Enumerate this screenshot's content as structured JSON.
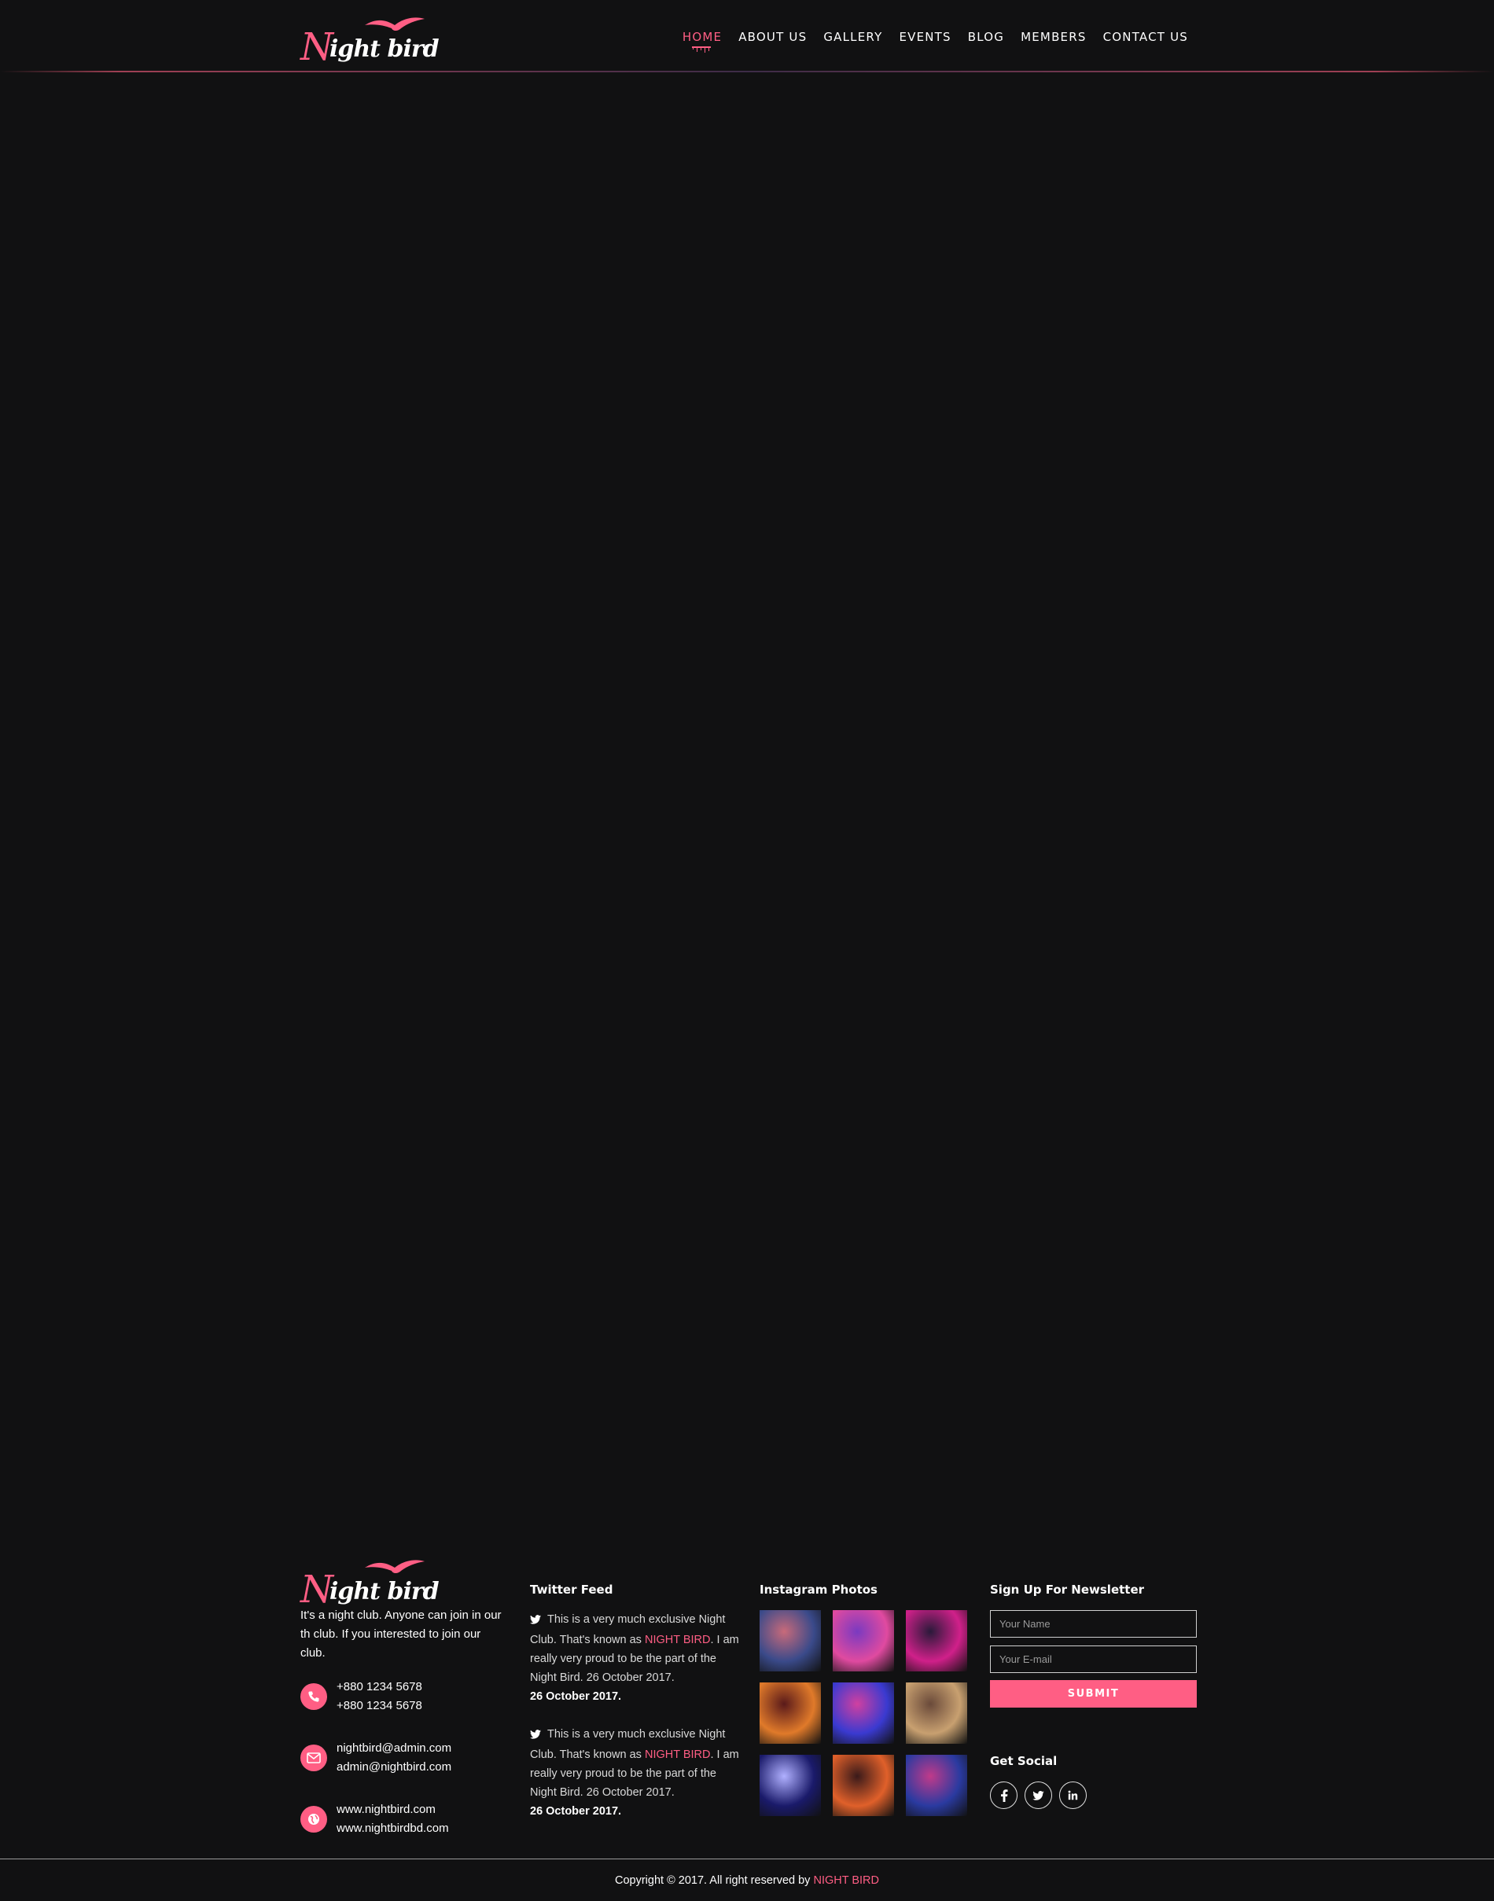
{
  "header": {
    "logo": {
      "text_cap": "N",
      "text_rest": "ight bird"
    },
    "nav": [
      {
        "label": "HOME",
        "active": true
      },
      {
        "label": "ABOUT US"
      },
      {
        "label": "GALLERY"
      },
      {
        "label": "EVENTS"
      },
      {
        "label": "BLOG"
      },
      {
        "label": "MEMBERS"
      },
      {
        "label": "CONTACT US"
      }
    ]
  },
  "footer": {
    "about": {
      "logo_cap": "N",
      "logo_rest": "ight bird",
      "description": "It's a night club. Anyone can join in our th club. If you interested to join our club.",
      "phones": [
        "+880 1234 5678",
        "+880 1234 5678"
      ],
      "emails": [
        "nightbird@admin.com",
        "admin@nightbird.com"
      ],
      "websites": [
        "www.nightbird.com",
        "www.nightbirdbd.com"
      ]
    },
    "twitter": {
      "heading": "Twitter Feed",
      "tweets": [
        {
          "pre": "This is a very much exclusive Night Club. That's known as ",
          "highlight": "NIGHT BIRD",
          "post": ". I am really very proud to be the part of the Night Bird. 26 October 2017.",
          "date": "26 October 2017."
        },
        {
          "pre": "This is a very much exclusive Night Club. That's known as ",
          "highlight": "NIGHT BIRD",
          "post": ". I am really very proud to be the part of the Night Bird. 26 October 2017.",
          "date": "26 October 2017."
        }
      ]
    },
    "instagram": {
      "heading": "Instagram Photos",
      "photos": [
        {
          "name": "photo-1",
          "c1": "#3a4a8a",
          "c2": "#c86a7a"
        },
        {
          "name": "photo-2",
          "c1": "#e04aa0",
          "c2": "#7a3ac0"
        },
        {
          "name": "photo-3",
          "c1": "#d0208a",
          "c2": "#2a1a3a"
        },
        {
          "name": "photo-4",
          "c1": "#e07a2a",
          "c2": "#5a1a1a"
        },
        {
          "name": "photo-5",
          "c1": "#3a3ad0",
          "c2": "#d040a0"
        },
        {
          "name": "photo-6",
          "c1": "#c8a070",
          "c2": "#6a4a3a"
        },
        {
          "name": "photo-7",
          "c1": "#1a1a6a",
          "c2": "#b0b0ff"
        },
        {
          "name": "photo-8",
          "c1": "#e0602a",
          "c2": "#3a1a1a"
        },
        {
          "name": "photo-9",
          "c1": "#2a3aa0",
          "c2": "#c03a8a"
        }
      ]
    },
    "newsletter": {
      "heading": "Sign Up For Newsletter",
      "name_placeholder": "Your Name",
      "email_placeholder": "Your E-mail",
      "submit_label": "SUBMIT"
    },
    "social": {
      "heading": "Get Social",
      "icons": [
        "facebook-icon",
        "twitter-icon",
        "linkedin-icon"
      ]
    },
    "copyright": {
      "text": "Copyright © 2017. All right reserved by ",
      "brand": "NIGHT BIRD"
    }
  },
  "colors": {
    "accent": "#ff5e84",
    "background": "#111112"
  }
}
